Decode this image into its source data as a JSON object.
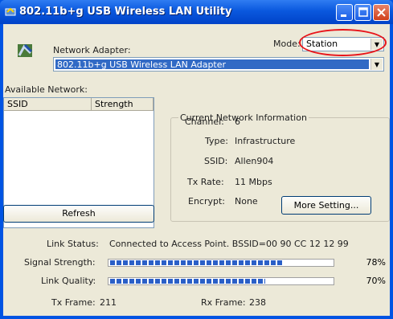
{
  "window": {
    "title": "802.11b+g USB Wireless LAN Utility"
  },
  "adapter": {
    "label": "Network Adapter:",
    "value": "802.11b+g USB Wireless LAN Adapter"
  },
  "mode": {
    "label": "Mode:",
    "value": "Station"
  },
  "available": {
    "label": "Available Network:",
    "columns": [
      "SSID",
      "Strength"
    ],
    "refresh_label": "Refresh"
  },
  "info": {
    "title": "Current Network Information",
    "channel_label": "Channel:",
    "channel": "6",
    "type_label": "Type:",
    "type": "Infrastructure",
    "ssid_label": "SSID:",
    "ssid": "Allen904",
    "rate_label": "Tx Rate:",
    "rate": "11 Mbps",
    "encrypt_label": "Encrypt:",
    "encrypt": "None",
    "more_label": "More Setting..."
  },
  "status": {
    "link_label": "Link Status:",
    "link_value": "Connected to Access Point. BSSID=00 90 CC 12 12 99",
    "signal_label": "Signal Strength:",
    "signal_pct": 78,
    "signal_text": "78%",
    "quality_label": "Link Quality:",
    "quality_pct": 70,
    "quality_text": "70%",
    "tx_label": "Tx Frame:",
    "tx_value": "211",
    "rx_label": "Rx Frame:",
    "rx_value": "238"
  },
  "colors": {
    "accent": "#0054e3",
    "highlight_circle": "#e8141a",
    "bar_fill": "#2a5fc7"
  }
}
